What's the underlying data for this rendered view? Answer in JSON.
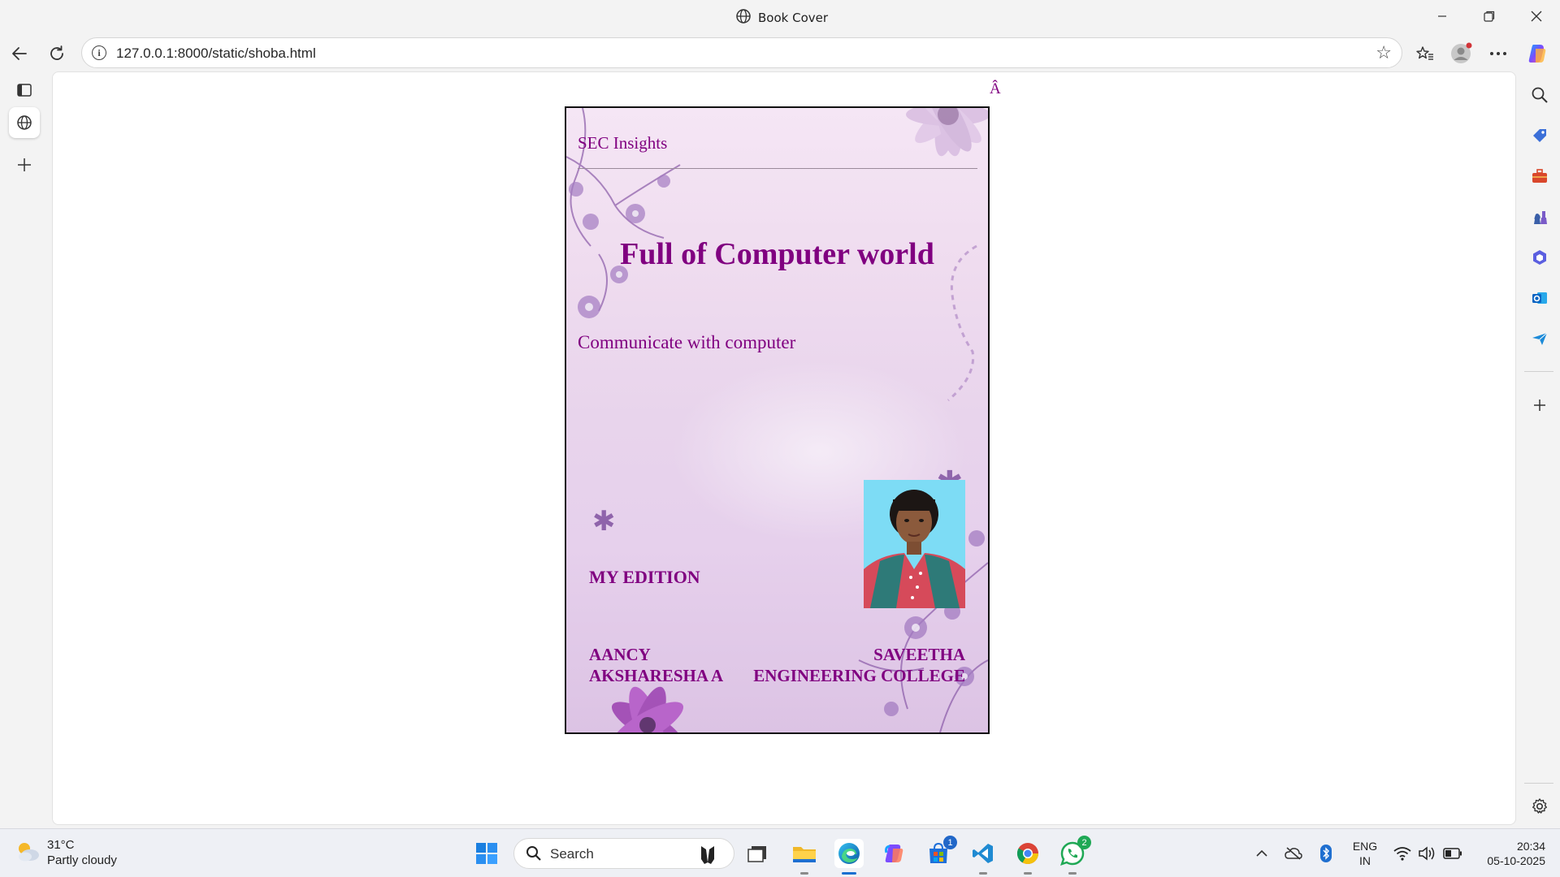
{
  "window": {
    "title": "Book Cover",
    "controls": {
      "minimize": "—",
      "maximize": "❐",
      "close": "✕"
    }
  },
  "browser": {
    "url": "127.0.0.1:8000/static/shoba.html",
    "nav_icons": [
      "back-icon",
      "refresh-icon"
    ],
    "toolbar_icons": [
      "favorite-star-icon",
      "favorites-icon",
      "profile-icon",
      "more-icon",
      "copilot-icon"
    ],
    "sidebar_icons": [
      "search-icon",
      "tag-icon",
      "toolbox-icon",
      "chess-icon",
      "microsoft365-icon",
      "outlook-icon",
      "send-icon",
      "add-icon",
      "settings-icon"
    ]
  },
  "page": {
    "stray_char": "Â",
    "cover": {
      "publisher": "SEC Insights",
      "title": "Full of Computer world",
      "subtitle": "Communicate with computer",
      "edition": "MY EDITION",
      "author_line1": "AANCY",
      "author_line2": "AKSHARESHA A",
      "college_line1": "SAVEETHA",
      "college_line2": "ENGINEERING COLLEGE",
      "title_color": "#800080"
    }
  },
  "taskbar": {
    "weather": {
      "temp": "31°C",
      "condition": "Partly cloudy"
    },
    "search_placeholder": "Search",
    "apps": [
      "start-icon",
      "search-icon",
      "game-icon",
      "task-view-icon",
      "file-explorer-icon",
      "edge-icon",
      "copilot-icon",
      "store-icon",
      "vscode-icon",
      "chrome-icon",
      "whatsapp-icon"
    ],
    "store_badge": "1",
    "whatsapp_badge": "2",
    "language": {
      "line1": "ENG",
      "line2": "IN"
    },
    "clock": {
      "time": "20:34",
      "date": "05-10-2025"
    }
  }
}
